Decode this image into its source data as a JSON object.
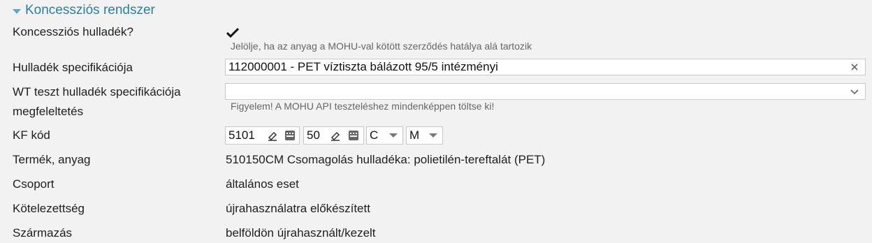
{
  "section": {
    "title": "Koncessziós rendszer"
  },
  "rows": {
    "koncesszios": {
      "label": "Koncessziós hulladék?",
      "checked": true,
      "hint": "Jelölje, ha az anyag a MOHU-val kötött szerződés hatálya alá tartozik"
    },
    "specifikacio": {
      "label": "Hulladék specifikációja",
      "value": "112000001 - PET víztiszta bálázott 95/5 intézményi"
    },
    "wt_teszt": {
      "label_line1": "WT teszt hulladék specifikációja",
      "label_line2": "megfeleltetés",
      "value": "",
      "hint": "Figyelem! A MOHU API teszteléshez mindenképpen töltse ki!"
    },
    "kf_kod": {
      "label": "KF kód",
      "part1": "5101",
      "part2": "50",
      "part3": "C",
      "part4": "M"
    },
    "termek": {
      "label": "Termék, anyag",
      "value": "510150CM Csomagolás hulladéka: polietilén-tereftalát (PET)"
    },
    "csoport": {
      "label": "Csoport",
      "value": "általános eset"
    },
    "kotelezettseg": {
      "label": "Kötelezettség",
      "value": "újrahasználatra előkészített"
    },
    "szarmazas": {
      "label": "Származás",
      "value": "belföldön újrahasznált/kezelt"
    }
  },
  "icons": {
    "section_toggle": "caret-down-icon",
    "check": "checkmark-icon",
    "clear": "close-icon",
    "dropdown": "chevron-down-icon",
    "edit": "eraser-icon",
    "keypad": "keypad-icon"
  },
  "colors": {
    "section_title": "#2e7fa3",
    "background": "#f2f2f2",
    "field_border": "#c9c9c9"
  }
}
